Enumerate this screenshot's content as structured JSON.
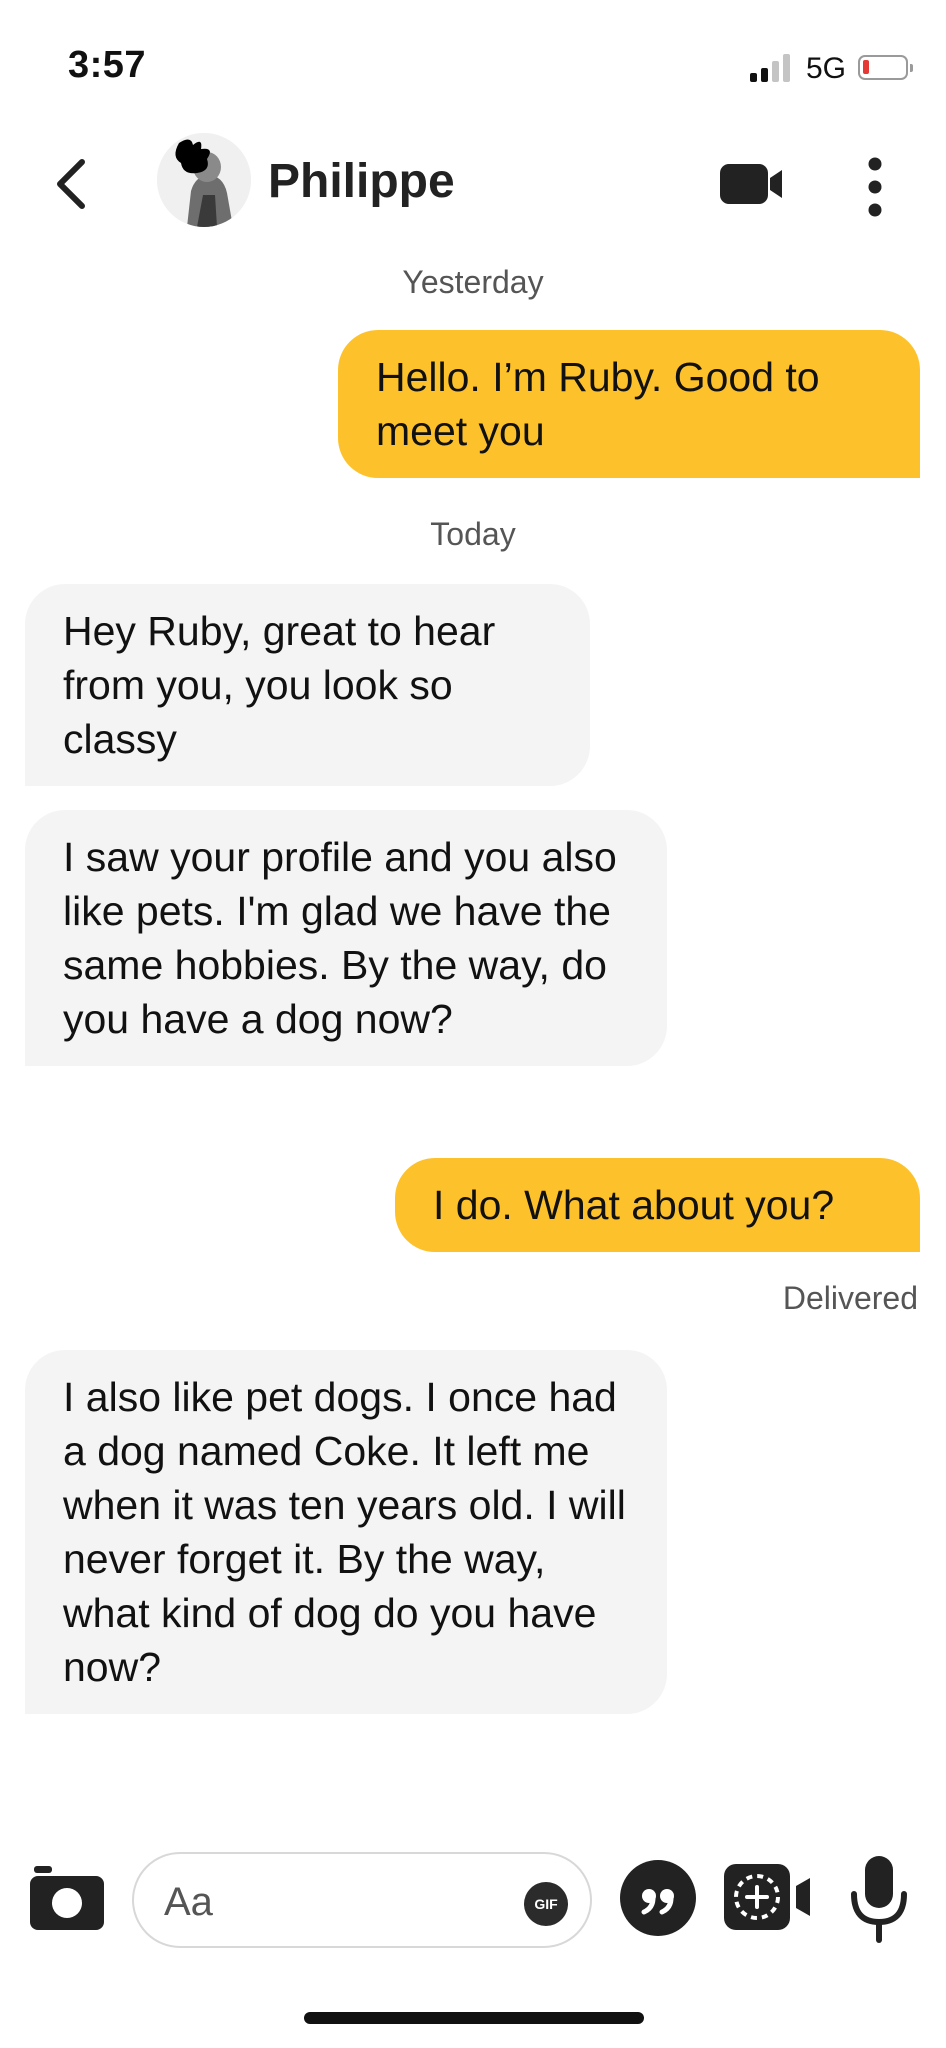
{
  "status_bar": {
    "time": "3:57",
    "network": "5G",
    "battery_level": 0.1,
    "battery_color": "#e53935"
  },
  "header": {
    "contact_name": "Philippe",
    "back_icon": "chevron-left-icon",
    "video_icon": "video-camera-icon",
    "more_icon": "more-vertical-icon"
  },
  "messages": {
    "date_1": "Yesterday",
    "m1": "Hello. I’m Ruby. Good to meet you",
    "date_2": "Today",
    "m2": "Hey Ruby, great to hear from you, you look so classy",
    "m3": "I saw your profile and you also like pets. I'm glad we have the same hobbies. By the way, do you have a dog now?",
    "m4": "I do. What about you?",
    "delivered": "Delivered",
    "m5": "I also like pet dogs. I once had a dog named Coke. It left me when it was ten years old. I will never forget it. By the way, what kind of dog do you have now?"
  },
  "composer": {
    "placeholder": "Aa",
    "value": "",
    "gif_label": "GIF"
  },
  "colors": {
    "outgoing_bubble": "#fdc22b",
    "incoming_bubble": "#f4f4f4"
  }
}
